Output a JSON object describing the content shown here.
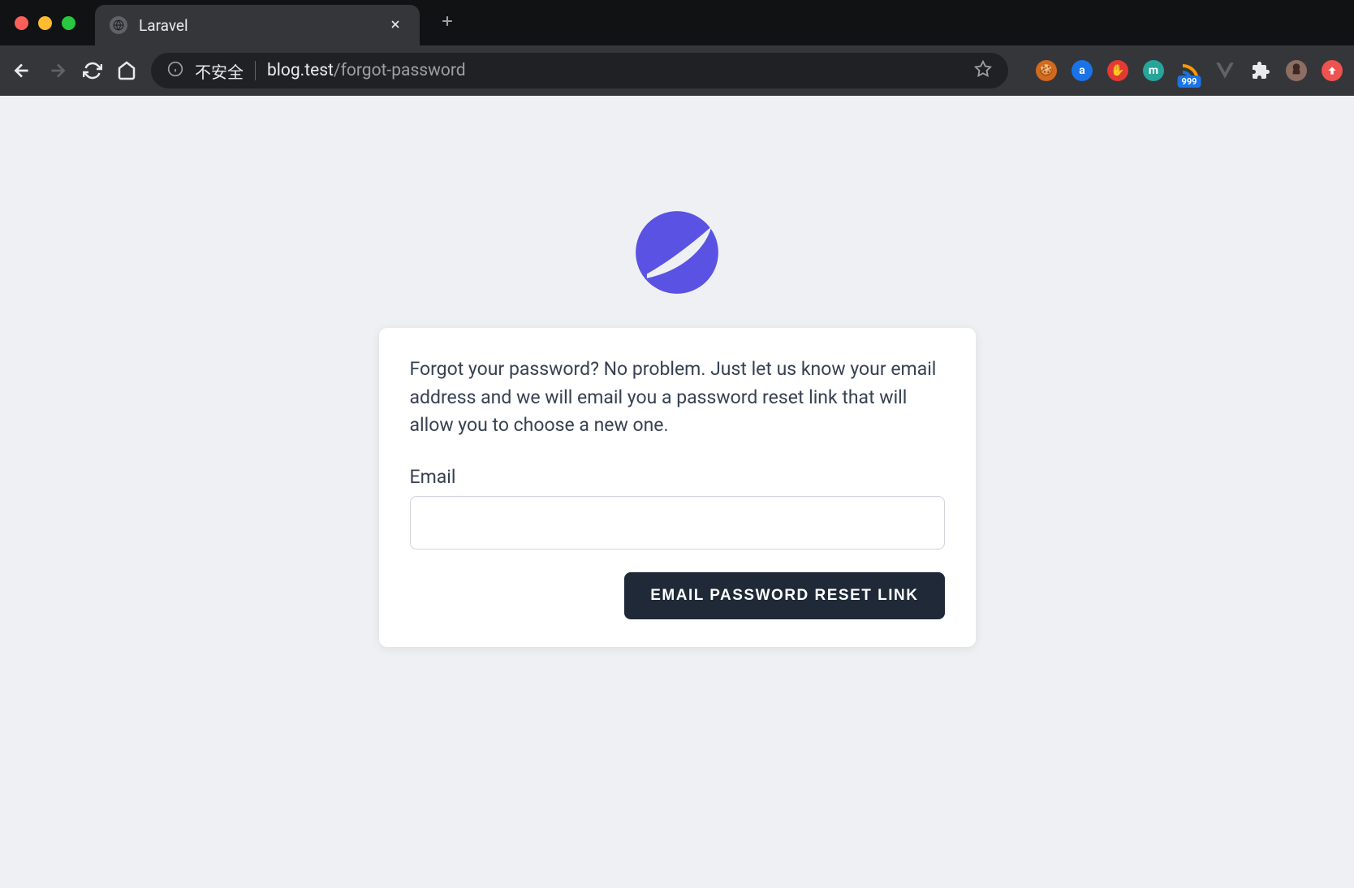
{
  "browser": {
    "tab_title": "Laravel",
    "security_label": "不安全",
    "url_host": "blog.test",
    "url_path": "/forgot-password",
    "badge_count": "999"
  },
  "page": {
    "description": "Forgot your password? No problem. Just let us know your email address and we will email you a password reset link that will allow you to choose a new one.",
    "email_label": "Email",
    "email_value": "",
    "submit_label": "EMAIL PASSWORD RESET LINK"
  },
  "colors": {
    "logo_primary": "#5a52e3",
    "button_bg": "#1f2937"
  }
}
